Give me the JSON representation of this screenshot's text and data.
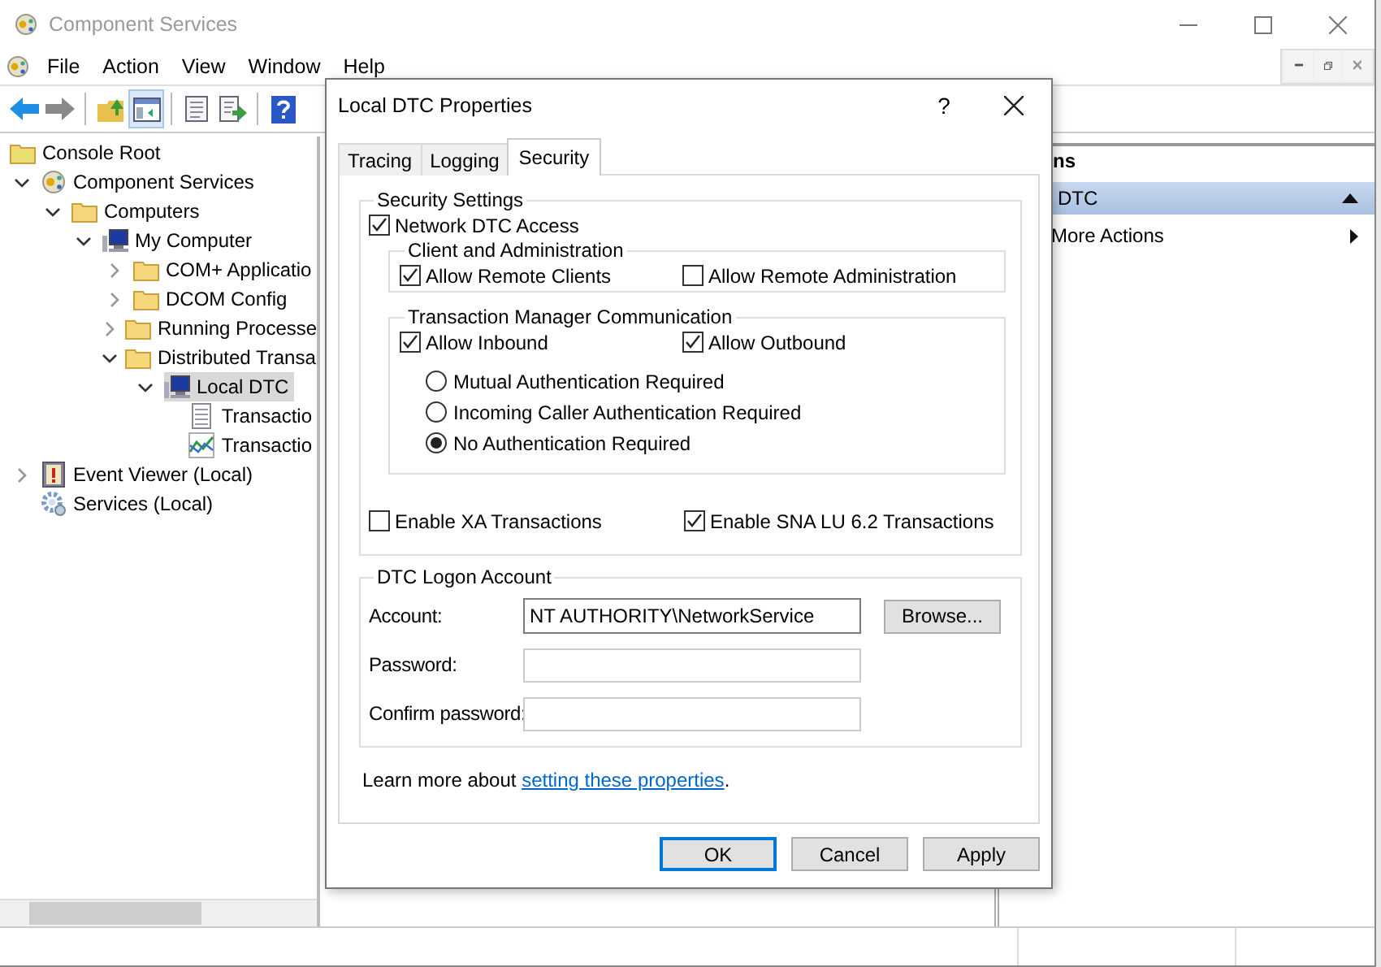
{
  "window": {
    "title": "Component Services"
  },
  "menu": [
    {
      "label": "File"
    },
    {
      "label": "Action"
    },
    {
      "label": "View"
    },
    {
      "label": "Window"
    },
    {
      "label": "Help"
    }
  ],
  "tree": {
    "label": "Console Root",
    "kind": "root",
    "selected": false,
    "children": [
      {
        "label": "Component Services",
        "kind": "component",
        "expanded": true,
        "selected": false,
        "children": [
          {
            "label": "Computers",
            "kind": "folder",
            "expanded": true,
            "selected": false,
            "children": [
              {
                "label": "My Computer",
                "kind": "computer",
                "expanded": true,
                "selected": false,
                "children": [
                  {
                    "label": "COM+ Applicatio",
                    "kind": "folder",
                    "expanded": false,
                    "selected": false
                  },
                  {
                    "label": "DCOM Config",
                    "kind": "folder",
                    "expanded": false,
                    "selected": false
                  },
                  {
                    "label": "Running Processe",
                    "kind": "folder",
                    "expanded": false,
                    "selected": false
                  },
                  {
                    "label": "Distributed Transa",
                    "kind": "folder",
                    "expanded": true,
                    "selected": false,
                    "children": [
                      {
                        "label": "Local DTC",
                        "kind": "computer",
                        "expanded": true,
                        "selected": true,
                        "children": [
                          {
                            "label": "Transactio",
                            "kind": "list",
                            "selected": false
                          },
                          {
                            "label": "Transactio",
                            "kind": "chart",
                            "selected": false
                          }
                        ]
                      }
                    ]
                  }
                ]
              }
            ]
          }
        ]
      },
      {
        "label": "Event Viewer (Local)",
        "kind": "event",
        "expanded": false,
        "selected": false
      },
      {
        "label": "Services (Local)",
        "kind": "gear",
        "selected": false
      }
    ]
  },
  "actions": {
    "header": "ns",
    "items": [
      {
        "label": "DTC",
        "kind": "section"
      },
      {
        "label": "More Actions",
        "kind": "submenu"
      }
    ]
  },
  "dialog": {
    "title": "Local DTC Properties",
    "help": "?",
    "tabs": [
      {
        "label": "Tracing",
        "selected": false
      },
      {
        "label": "Logging",
        "selected": false
      },
      {
        "label": "Security",
        "selected": true
      }
    ],
    "security": {
      "legend": "Security Settings",
      "network_access": {
        "label": "Network DTC Access",
        "checked": true
      },
      "client_admin": {
        "legend": "Client and Administration",
        "options": [
          {
            "label": "Allow Remote Clients",
            "checked": true
          },
          {
            "label": "Allow Remote Administration",
            "checked": false
          }
        ]
      },
      "tm_comm": {
        "legend": "Transaction Manager Communication",
        "options": [
          {
            "label": "Allow Inbound",
            "checked": true
          },
          {
            "label": "Allow Outbound",
            "checked": true
          }
        ],
        "auth": [
          {
            "label": "Mutual Authentication Required",
            "selected": false
          },
          {
            "label": "Incoming Caller Authentication Required",
            "selected": false
          },
          {
            "label": "No Authentication Required",
            "selected": true
          }
        ]
      },
      "extra": [
        {
          "label": "Enable XA Transactions",
          "checked": false
        },
        {
          "label": "Enable SNA LU 6.2 Transactions",
          "checked": true
        }
      ]
    },
    "logon": {
      "legend": "DTC Logon Account",
      "browse": "Browse...",
      "fields": [
        {
          "label": "Account:",
          "value": "NT AUTHORITY\\NetworkService"
        },
        {
          "label": "Password:"
        },
        {
          "label": "Confirm password:"
        }
      ]
    },
    "learn_more": {
      "text": "Learn more about ",
      "link": "setting these properties",
      "end": "."
    },
    "buttons": [
      {
        "label": "OK",
        "default": true
      },
      {
        "label": "Cancel",
        "default": false
      },
      {
        "label": "Apply",
        "default": false
      }
    ]
  }
}
